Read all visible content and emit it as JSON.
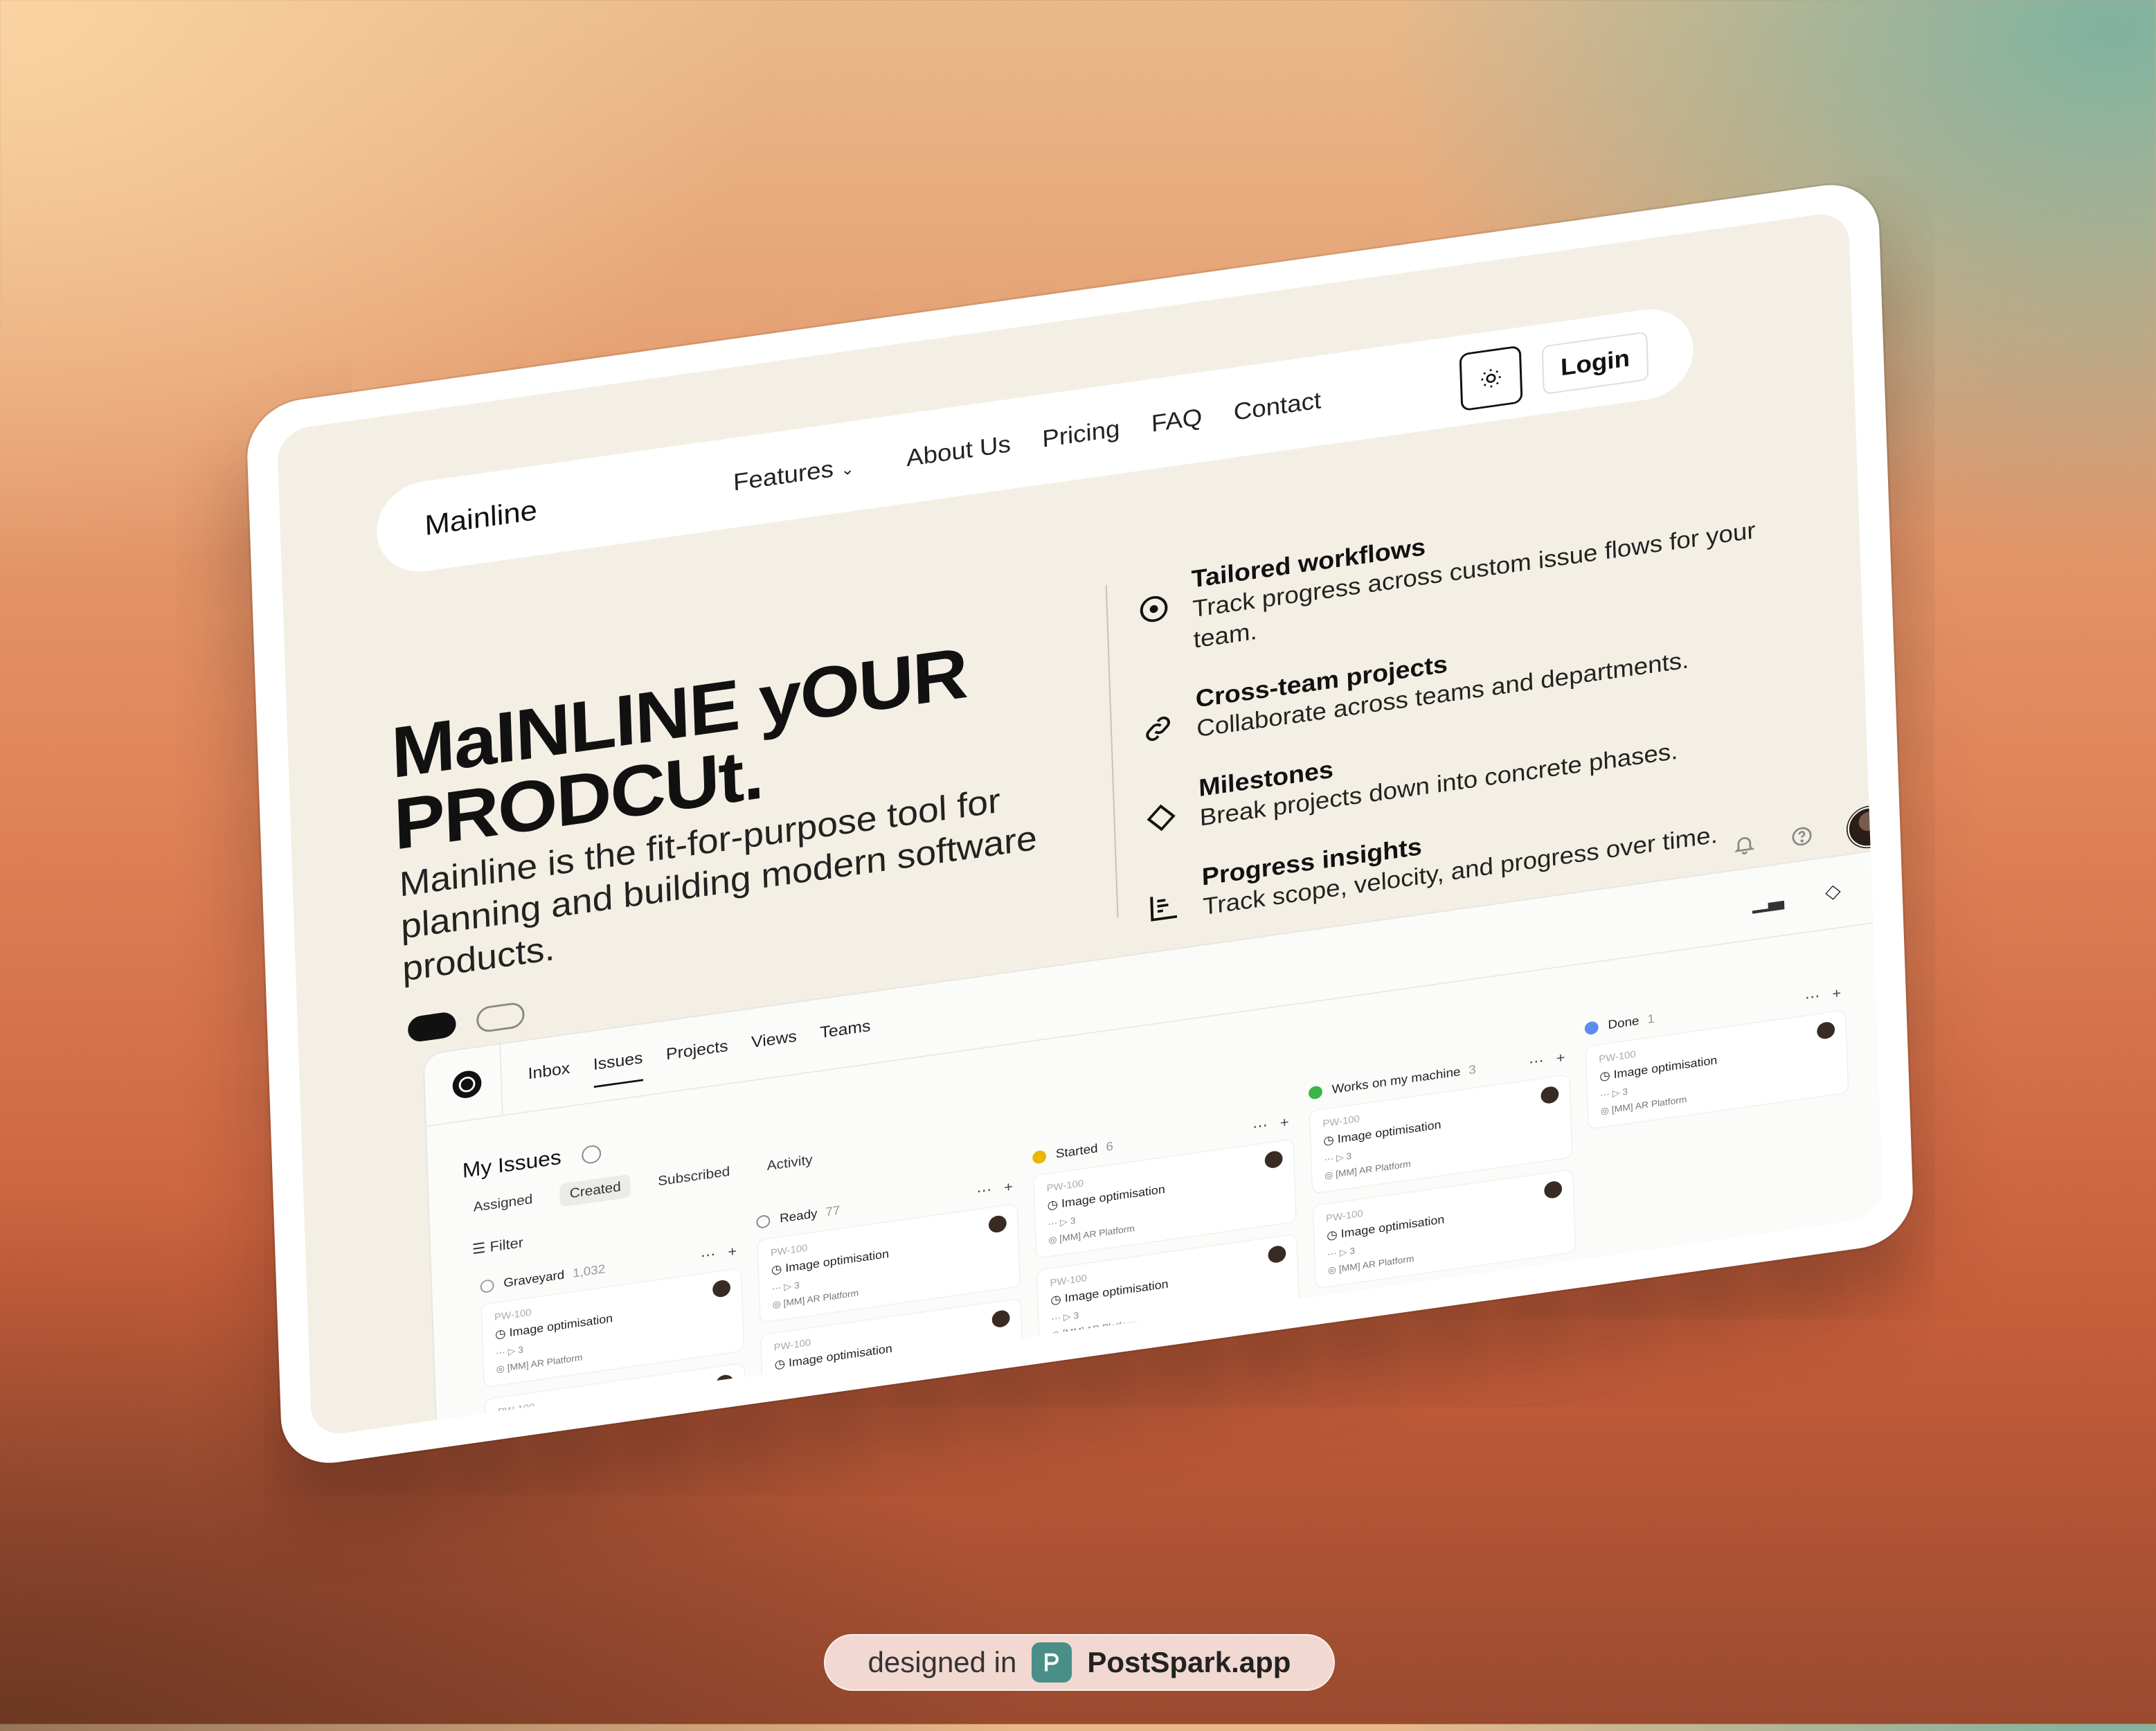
{
  "nav": {
    "brand": "Mainline",
    "items": [
      {
        "label": "Features",
        "has_dropdown": true
      },
      {
        "label": "About Us"
      },
      {
        "label": "Pricing"
      },
      {
        "label": "FAQ"
      },
      {
        "label": "Contact"
      }
    ],
    "login": "Login",
    "theme_toggle_icon": "sun-icon"
  },
  "hero": {
    "title": "MaINLINE yOUR PRODCUt.",
    "subtitle": "Mainline is the fit-for-purpose tool for planning and building modern software products."
  },
  "features": [
    {
      "title": "Tailored workflows",
      "desc": "Track progress across custom issue flows for your team.",
      "icon": "circle-dot-icon"
    },
    {
      "title": "Cross-team projects",
      "desc": "Collaborate across teams and departments.",
      "icon": "link-icon"
    },
    {
      "title": "Milestones",
      "desc": "Break projects down into concrete phases.",
      "icon": "diamond-icon"
    },
    {
      "title": "Progress insights",
      "desc": "Track scope, velocity, and progress over time.",
      "icon": "chart-icon"
    }
  ],
  "app": {
    "tabs": [
      "Inbox",
      "Issues",
      "Projects",
      "Views",
      "Teams"
    ],
    "active_tab": "Issues",
    "section_title": "My Issues",
    "subtabs": [
      "Assigned",
      "Created",
      "Subscribed",
      "Activity"
    ],
    "active_subtab": "Created",
    "filter": "Filter",
    "columns": [
      {
        "name": "Graveyard",
        "count": "1,032",
        "color": "#9a9a9a"
      },
      {
        "name": "Ready",
        "count": "77",
        "color": "#8a8a8a"
      },
      {
        "name": "Started",
        "count": "6",
        "color": "#e8b800"
      },
      {
        "name": "Works on my machine",
        "count": "3",
        "color": "#3bb54a"
      },
      {
        "name": "Done",
        "count": "1",
        "color": "#5b8def"
      }
    ],
    "card": {
      "id": "PW-100",
      "title": "Image optimisation",
      "subtasks": "3",
      "platform": "[MM] AR Platform"
    }
  },
  "badge": {
    "prefix": "designed in",
    "name": "PostSpark.app"
  }
}
